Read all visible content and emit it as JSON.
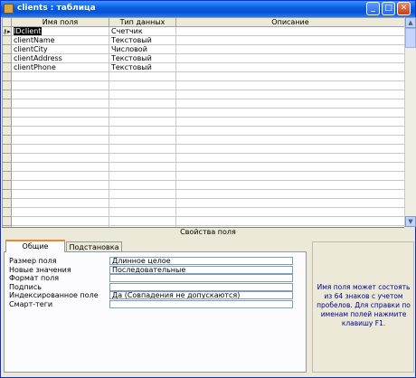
{
  "window": {
    "title": "clients : таблица",
    "controls": {
      "minimize": "_",
      "maximize": "□",
      "close": "✕"
    }
  },
  "grid": {
    "columns": [
      "Имя поля",
      "Тип данных",
      "Описание"
    ],
    "selector_glyph": "⚷▸",
    "rows": [
      {
        "name": "IDclient",
        "type": "Счетчик",
        "description": "",
        "selected": true
      },
      {
        "name": "clientName",
        "type": "Текстовый",
        "description": ""
      },
      {
        "name": "clientCity",
        "type": "Числовой",
        "description": ""
      },
      {
        "name": "clientAddress",
        "type": "Текстовый",
        "description": ""
      },
      {
        "name": "clientPhone",
        "type": "Текстовый",
        "description": ""
      }
    ],
    "empty_rows": 20
  },
  "properties": {
    "caption": "Свойства поля",
    "tabs": [
      "Общие",
      "Подстановка"
    ],
    "active_tab": "Общие",
    "rows": [
      {
        "label": "Размер поля",
        "value": "Длинное целое"
      },
      {
        "label": "Новые значения",
        "value": "Последовательные"
      },
      {
        "label": "Формат поля",
        "value": ""
      },
      {
        "label": "Подпись",
        "value": ""
      },
      {
        "label": "Индексированное поле",
        "value": "Да (Совпадения не допускаются)"
      },
      {
        "label": "Смарт-теги",
        "value": ""
      }
    ],
    "help": "Имя поля может состоять из 64 знаков с учетом пробелов. Для справки по именам полей нажмите клавишу F1."
  }
}
